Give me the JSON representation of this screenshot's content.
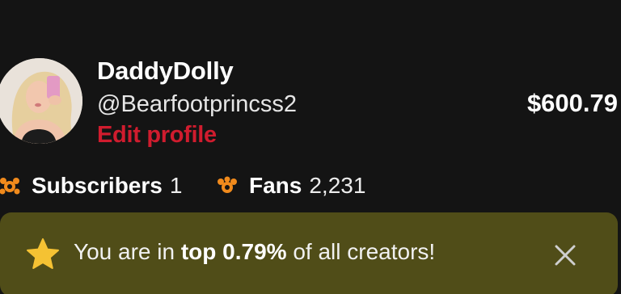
{
  "profile": {
    "display_name": "DaddyDolly",
    "username": "@Bearfootprincss2",
    "edit_label": "Edit profile",
    "earnings": "$600.79"
  },
  "stats": {
    "subscribers": {
      "label": "Subscribers",
      "value": "1",
      "icon": "subscribers-icon"
    },
    "fans": {
      "label": "Fans",
      "value": "2,231",
      "icon": "fans-icon"
    }
  },
  "banner": {
    "prefix": "You are in ",
    "highlight": "top 0.79%",
    "suffix": " of all creators!",
    "icon": "star-icon",
    "close_icon": "close-icon"
  },
  "colors": {
    "background": "#141414",
    "accent_red": "#d01c2e",
    "icon_orange": "#f08a1c",
    "banner_bg": "#504d18",
    "star_yellow": "#f5c233"
  }
}
